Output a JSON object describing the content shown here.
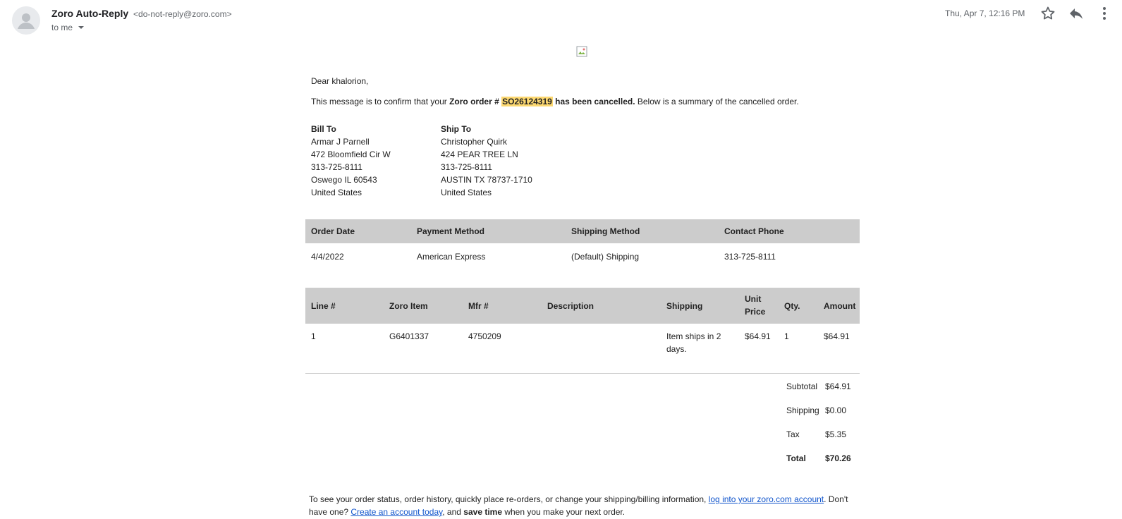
{
  "email": {
    "sender_name": "Zoro Auto-Reply",
    "sender_address": "<do-not-reply@zoro.com>",
    "recipient": "to me",
    "date": "Thu, Apr 7, 12:16 PM",
    "icons": {
      "avatar": "person-avatar-icon",
      "star": "star-icon",
      "reply": "reply-icon",
      "more": "more-vert-icon",
      "caret": "caret-down-icon",
      "image": "broken-image-icon"
    }
  },
  "body": {
    "greeting": "Dear khalorion,",
    "confirm": {
      "prefix": "This message is to confirm that your ",
      "order_label": "Zoro order # ",
      "order_number": "SO26124319",
      "cancelled": " has been cancelled.",
      "suffix": " Below is a summary of the cancelled order."
    },
    "bill_to": {
      "label": "Bill To",
      "lines": [
        "Armar J Parnell",
        "472 Bloomfield Cir W",
        "313-725-8111",
        "Oswego IL 60543",
        "United States"
      ]
    },
    "ship_to": {
      "label": "Ship To",
      "lines": [
        "Christopher Quirk",
        "424 PEAR TREE LN",
        "313-725-8111",
        "AUSTIN TX 78737-1710",
        "United States"
      ]
    },
    "order_info": {
      "headers": [
        "Order Date",
        "Payment Method",
        "Shipping Method",
        "Contact Phone"
      ],
      "values": [
        "4/4/2022",
        "American Express",
        "(Default) Shipping",
        "313-725-8111"
      ]
    },
    "items": {
      "headers": [
        "Line #",
        "Zoro Item",
        "Mfr #",
        "Description",
        "Shipping",
        "Unit Price",
        "Qty.",
        "Amount"
      ],
      "unit_price_line1": "Unit",
      "unit_price_line2": "Price",
      "rows": [
        {
          "line": "1",
          "zoro_item": "G6401337",
          "mfr": "4750209",
          "description": "",
          "shipping_line1": "Item ships in 2",
          "shipping_line2": "days.",
          "unit_price": "$64.91",
          "qty": "1",
          "amount": "$64.91"
        }
      ]
    },
    "totals": {
      "subtotal_label": "Subtotal",
      "subtotal": "$64.91",
      "shipping_label": "Shipping",
      "shipping": "$0.00",
      "tax_label": "Tax",
      "tax": "$5.35",
      "total_label": "Total",
      "total": "$70.26"
    },
    "footer": {
      "part1": "To see your order status, order history, quickly place re-orders, or change your shipping/billing information, ",
      "link1": "log into your zoro.com account",
      "part2": ". Don't have one? ",
      "link2": "Create an account today",
      "part3": ", and ",
      "bold": "save time",
      "part4": " when you make your next order."
    }
  }
}
